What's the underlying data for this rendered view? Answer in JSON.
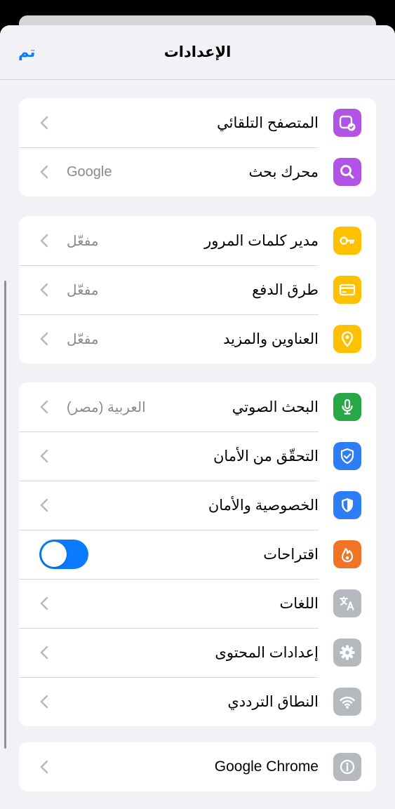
{
  "header": {
    "title": "الإعدادات",
    "done_label": "تم"
  },
  "groups": [
    {
      "items": [
        {
          "label": "المتصفح التلقائي",
          "value": "",
          "icon": "browser-check-icon",
          "color": "#b154e6"
        },
        {
          "label": "محرك بحث",
          "value": "Google",
          "icon": "search-icon",
          "color": "#b154e6"
        }
      ]
    },
    {
      "items": [
        {
          "label": "مدير كلمات المرور",
          "value": "مفعّل",
          "icon": "key-icon",
          "color": "#ffc000"
        },
        {
          "label": "طرق الدفع",
          "value": "مفعّل",
          "icon": "credit-card-icon",
          "color": "#ffc000"
        },
        {
          "label": "العناوين والمزيد",
          "value": "مفعّل",
          "icon": "location-pin-icon",
          "color": "#ffc000"
        }
      ]
    },
    {
      "items": [
        {
          "label": "البحث الصوتي",
          "value": "العربية (مصر)",
          "icon": "microphone-icon",
          "color": "#27a844"
        },
        {
          "label": "التحقّق من الأمان",
          "value": "",
          "icon": "shield-check-icon",
          "color": "#2f7df6"
        },
        {
          "label": "الخصوصية والأمان",
          "value": "",
          "icon": "shield-icon",
          "color": "#2f7df6"
        },
        {
          "label": "اقتراحات",
          "value": "",
          "icon": "flame-icon",
          "color": "#f07424",
          "toggle_on": true
        },
        {
          "label": "اللغات",
          "value": "",
          "icon": "translate-icon",
          "color": "#b5b8bd"
        },
        {
          "label": "إعدادات المحتوى",
          "value": "",
          "icon": "gear-icon",
          "color": "#b5b8bd"
        },
        {
          "label": "النطاق الترددي",
          "value": "",
          "icon": "wifi-icon",
          "color": "#b5b8bd"
        }
      ]
    },
    {
      "items": [
        {
          "label": "Google Chrome",
          "value": "",
          "icon": "info-icon",
          "color": "#b5b8bd"
        }
      ]
    }
  ]
}
